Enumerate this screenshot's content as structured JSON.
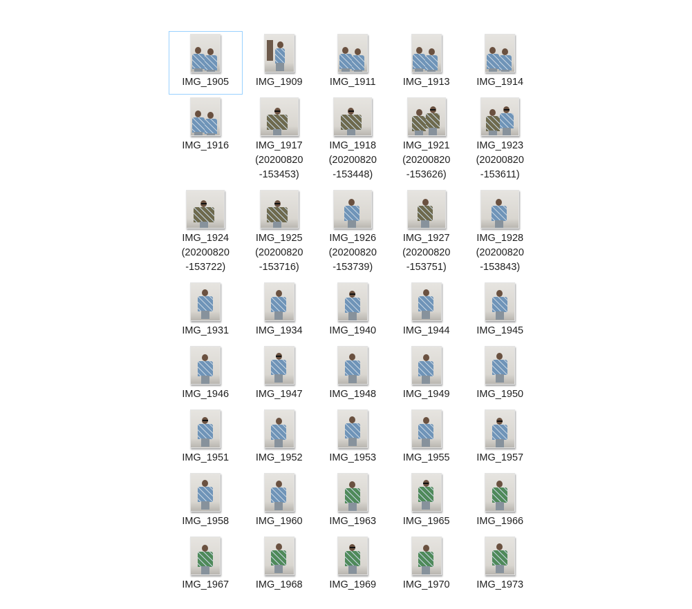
{
  "files": [
    {
      "name": "IMG_1905",
      "lines": [
        "IMG_1905"
      ],
      "selected": true,
      "kind": "group-seated",
      "shirt": "blue"
    },
    {
      "name": "IMG_1909",
      "lines": [
        "IMG_1909"
      ],
      "kind": "door-standing",
      "shirt": "blue"
    },
    {
      "name": "IMG_1911",
      "lines": [
        "IMG_1911"
      ],
      "kind": "group-seated",
      "shirt": "blue"
    },
    {
      "name": "IMG_1913",
      "lines": [
        "IMG_1913"
      ],
      "kind": "group-seated",
      "shirt": "blue"
    },
    {
      "name": "IMG_1914",
      "lines": [
        "IMG_1914"
      ],
      "kind": "group-seated",
      "shirt": "blue"
    },
    {
      "name": "IMG_1916",
      "lines": [
        "IMG_1916"
      ],
      "kind": "group-seated",
      "shirt": "blue"
    },
    {
      "name": "IMG_1917 (20200820-153453)",
      "lines": [
        "IMG_1917",
        "(20200820",
        "-153453)"
      ],
      "kind": "landscape-pose",
      "shirt": "camo"
    },
    {
      "name": "IMG_1918 (20200820-153448)",
      "lines": [
        "IMG_1918",
        "(20200820",
        "-153448)"
      ],
      "kind": "landscape-pose",
      "shirt": "camo"
    },
    {
      "name": "IMG_1921 (20200820-153626)",
      "lines": [
        "IMG_1921",
        "(20200820",
        "-153626)"
      ],
      "kind": "landscape-group",
      "shirt": "camo"
    },
    {
      "name": "IMG_1923 (20200820-153611)",
      "lines": [
        "IMG_1923",
        "(20200820",
        "-153611)"
      ],
      "kind": "landscape-group",
      "shirt": "blue"
    },
    {
      "name": "IMG_1924 (20200820-153722)",
      "lines": [
        "IMG_1924",
        "(20200820",
        "-153722)"
      ],
      "kind": "landscape-pose",
      "shirt": "camo"
    },
    {
      "name": "IMG_1925 (20200820-153716)",
      "lines": [
        "IMG_1925",
        "(20200820",
        "-153716)"
      ],
      "kind": "landscape-pose",
      "shirt": "camo"
    },
    {
      "name": "IMG_1926 (20200820-153739)",
      "lines": [
        "IMG_1926",
        "(20200820",
        "-153739)"
      ],
      "kind": "landscape-single",
      "shirt": "blue"
    },
    {
      "name": "IMG_1927 (20200820-153751)",
      "lines": [
        "IMG_1927",
        "(20200820",
        "-153751)"
      ],
      "kind": "landscape-single",
      "shirt": "camo"
    },
    {
      "name": "IMG_1928 (20200820-153843)",
      "lines": [
        "IMG_1928",
        "(20200820",
        "-153843)"
      ],
      "kind": "landscape-single",
      "shirt": "blue"
    },
    {
      "name": "IMG_1931",
      "lines": [
        "IMG_1931"
      ],
      "kind": "single",
      "shirt": "blue"
    },
    {
      "name": "IMG_1934",
      "lines": [
        "IMG_1934"
      ],
      "kind": "single",
      "shirt": "blue"
    },
    {
      "name": "IMG_1940",
      "lines": [
        "IMG_1940"
      ],
      "kind": "single",
      "shirt": "blue"
    },
    {
      "name": "IMG_1944",
      "lines": [
        "IMG_1944"
      ],
      "kind": "single",
      "shirt": "blue"
    },
    {
      "name": "IMG_1945",
      "lines": [
        "IMG_1945"
      ],
      "kind": "single",
      "shirt": "blue"
    },
    {
      "name": "IMG_1946",
      "lines": [
        "IMG_1946"
      ],
      "kind": "single",
      "shirt": "blue"
    },
    {
      "name": "IMG_1947",
      "lines": [
        "IMG_1947"
      ],
      "kind": "single",
      "shirt": "blue"
    },
    {
      "name": "IMG_1948",
      "lines": [
        "IMG_1948"
      ],
      "kind": "single",
      "shirt": "blue"
    },
    {
      "name": "IMG_1949",
      "lines": [
        "IMG_1949"
      ],
      "kind": "single",
      "shirt": "blue"
    },
    {
      "name": "IMG_1950",
      "lines": [
        "IMG_1950"
      ],
      "kind": "single",
      "shirt": "blue"
    },
    {
      "name": "IMG_1951",
      "lines": [
        "IMG_1951"
      ],
      "kind": "single",
      "shirt": "blue"
    },
    {
      "name": "IMG_1952",
      "lines": [
        "IMG_1952"
      ],
      "kind": "single",
      "shirt": "blue"
    },
    {
      "name": "IMG_1953",
      "lines": [
        "IMG_1953"
      ],
      "kind": "single",
      "shirt": "blue"
    },
    {
      "name": "IMG_1955",
      "lines": [
        "IMG_1955"
      ],
      "kind": "single",
      "shirt": "blue"
    },
    {
      "name": "IMG_1957",
      "lines": [
        "IMG_1957"
      ],
      "kind": "single",
      "shirt": "blue"
    },
    {
      "name": "IMG_1958",
      "lines": [
        "IMG_1958"
      ],
      "kind": "single",
      "shirt": "blue"
    },
    {
      "name": "IMG_1960",
      "lines": [
        "IMG_1960"
      ],
      "kind": "single",
      "shirt": "blue"
    },
    {
      "name": "IMG_1963",
      "lines": [
        "IMG_1963"
      ],
      "kind": "single",
      "shirt": "green"
    },
    {
      "name": "IMG_1965",
      "lines": [
        "IMG_1965"
      ],
      "kind": "single",
      "shirt": "green"
    },
    {
      "name": "IMG_1966",
      "lines": [
        "IMG_1966"
      ],
      "kind": "single",
      "shirt": "green"
    },
    {
      "name": "IMG_1967",
      "lines": [
        "IMG_1967"
      ],
      "kind": "single",
      "shirt": "green"
    },
    {
      "name": "IMG_1968",
      "lines": [
        "IMG_1968"
      ],
      "kind": "single",
      "shirt": "green"
    },
    {
      "name": "IMG_1969",
      "lines": [
        "IMG_1969"
      ],
      "kind": "single",
      "shirt": "green"
    },
    {
      "name": "IMG_1970",
      "lines": [
        "IMG_1970"
      ],
      "kind": "single",
      "shirt": "green"
    },
    {
      "name": "IMG_1973",
      "lines": [
        "IMG_1973"
      ],
      "kind": "single",
      "shirt": "green"
    }
  ],
  "colors": {
    "selection_border": "#99d1ff",
    "label_text": "#202020",
    "wall": "#e6e4e0",
    "shirt_blue": "#6f94b8",
    "shirt_camo": "#6e6a4e",
    "shirt_green": "#4f8a5a"
  },
  "icons": {
    "thumbnail": "photo-thumbnail-icon"
  }
}
